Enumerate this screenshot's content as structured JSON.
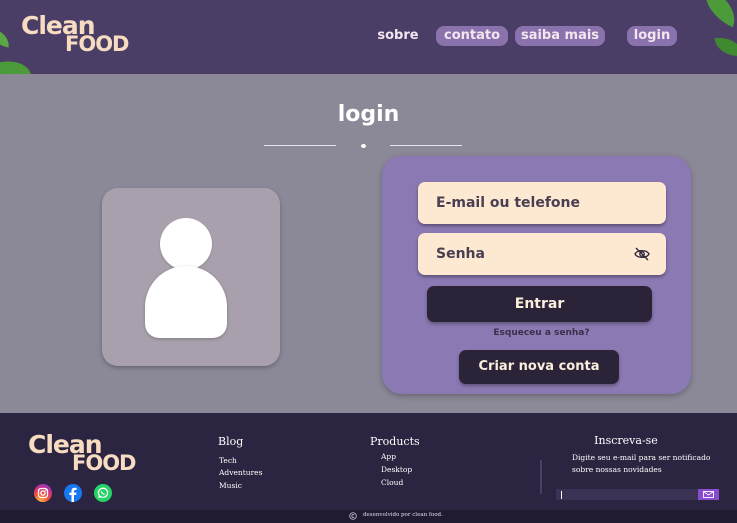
{
  "brand": {
    "line1": "Clean",
    "line2": "FOOD"
  },
  "nav": {
    "sobre": "sobre",
    "contato": "contato",
    "saiba_mais": "saiba mais",
    "login": "login"
  },
  "main": {
    "title": "login",
    "form": {
      "email_placeholder": "E-mail ou telefone",
      "password_placeholder": "Senha",
      "enter_label": "Entrar",
      "forgot_label": "Esqueceu a senha?",
      "create_label": "Criar nova conta"
    }
  },
  "footer": {
    "blog": {
      "title": "Blog",
      "items": [
        "Tech",
        "Adventures",
        "Music"
      ]
    },
    "products": {
      "title": "Products",
      "items": [
        "App",
        "Desktop",
        "Cloud"
      ]
    },
    "subscribe": {
      "title": "Inscreva-se",
      "description": "Digite seu e-mail para ser notificado sobre nossas novidades"
    },
    "social": [
      "instagram-icon",
      "facebook-icon",
      "whatsapp-icon"
    ],
    "copyright": "desenvolvido por clean food."
  },
  "colors": {
    "header_bg": "#4b3e66",
    "page_bg": "#8b8898",
    "card_bg": "#8b79b3",
    "field_bg": "#fde8d2",
    "button_bg": "#2b2438",
    "footer_bg": "#2c2541",
    "accent": "#8a73ad"
  }
}
